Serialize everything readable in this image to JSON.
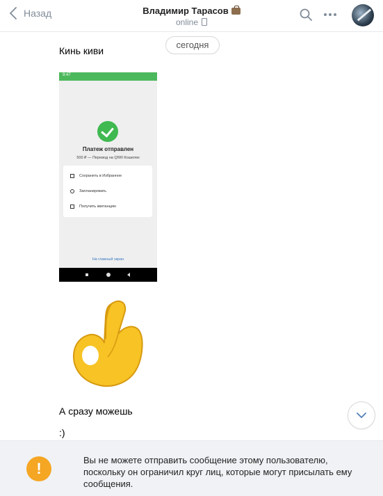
{
  "header": {
    "back_label": "Назад",
    "title": "Владимир Тарасов",
    "status": "online"
  },
  "date_separator": "сегодня",
  "messages": [
    {
      "text": "Кинь киви"
    },
    {
      "text": "А сразу можешь"
    },
    {
      "text": ":)"
    }
  ],
  "screenshot": {
    "time": "9:47",
    "title": "Платеж отправлен",
    "subtitle": "500 ₽ — Перевод на QIWI Кошелек",
    "options": [
      "Сохранить в Избранное",
      "Запланировать",
      "Получить квитанцию"
    ],
    "link": "На главный экран"
  },
  "notice": {
    "text": "Вы не можете отправить сообщение этому пользователю, поскольку он ограничил круг лиц, которые могут присылать ему сообщения.",
    "icon": "!"
  },
  "colors": {
    "accent": "#818c99",
    "green": "#4cb85c",
    "warning": "#f5a623",
    "sticker": "#f7c325"
  }
}
